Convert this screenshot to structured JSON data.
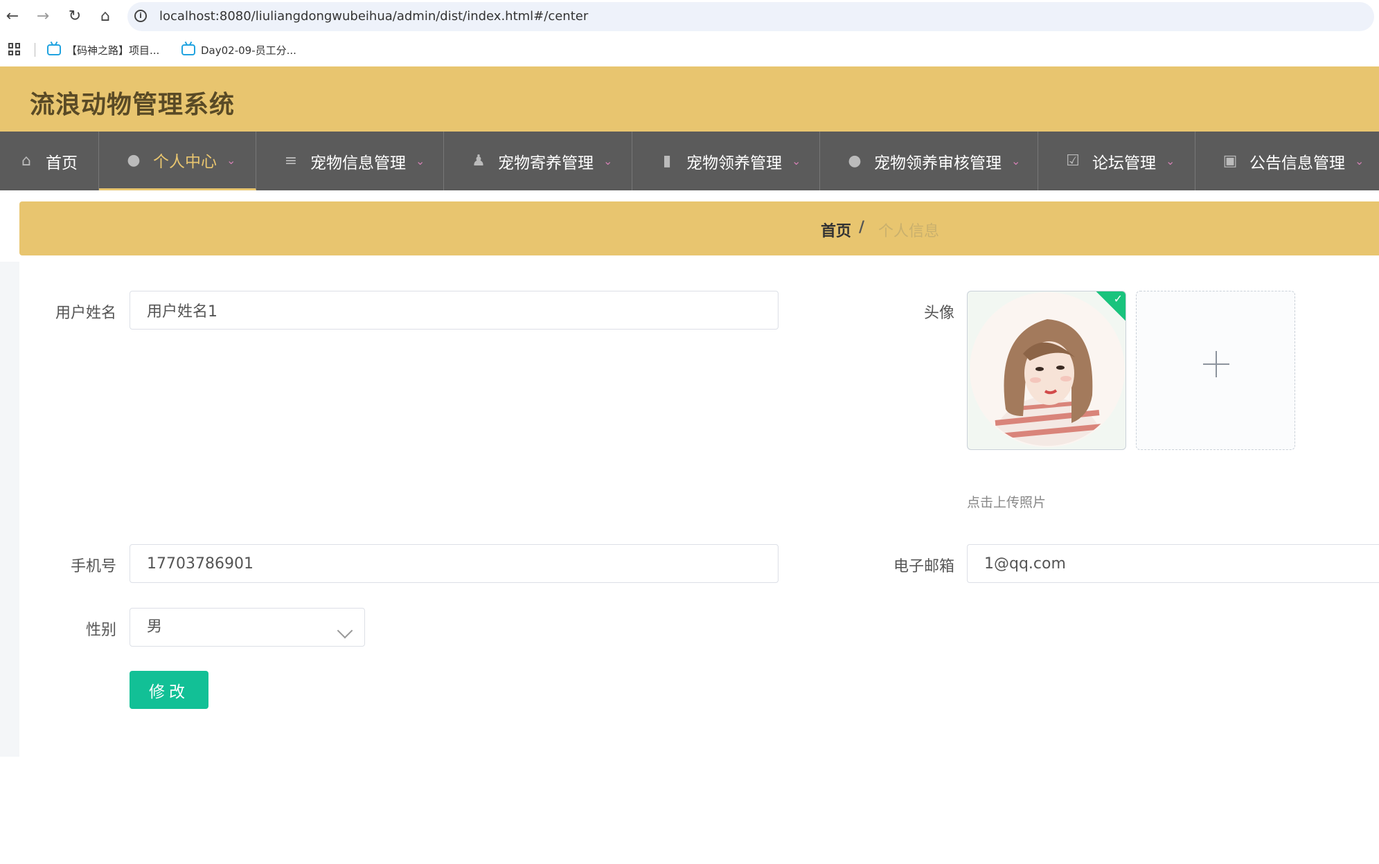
{
  "browser": {
    "url": "localhost:8080/liuliangdongwubeihua/admin/dist/index.html#/center",
    "bookmarks": [
      {
        "label": "【码神之路】项目..."
      },
      {
        "label": "Day02-09-员工分..."
      }
    ]
  },
  "app": {
    "title": "流浪动物管理系统"
  },
  "nav": {
    "items": [
      {
        "label": "首页",
        "icon": "home-icon"
      },
      {
        "label": "个人中心",
        "icon": "user-icon",
        "active": true
      },
      {
        "label": "宠物信息管理",
        "icon": "list-icon"
      },
      {
        "label": "宠物寄养管理",
        "icon": "person-icon"
      },
      {
        "label": "宠物领养管理",
        "icon": "chat-icon"
      },
      {
        "label": "宠物领养审核管理",
        "icon": "bulb-icon"
      },
      {
        "label": "论坛管理",
        "icon": "clipboard-icon"
      },
      {
        "label": "公告信息管理",
        "icon": "wallet-icon"
      }
    ]
  },
  "breadcrumb": {
    "home": "首页",
    "separator": "/",
    "current": "个人信息"
  },
  "form": {
    "username": {
      "label": "用户姓名",
      "value": "用户姓名1"
    },
    "avatar": {
      "label": "头像",
      "upload_tip": "点击上传照片"
    },
    "phone": {
      "label": "手机号",
      "value": "17703786901"
    },
    "email": {
      "label": "电子邮箱",
      "value": "1@qq.com"
    },
    "gender": {
      "label": "性别",
      "value": "男"
    },
    "submit_label": "修改"
  },
  "colors": {
    "header": "#e8c56f",
    "nav_bg": "#5b5b5b",
    "accent": "#12c096"
  }
}
